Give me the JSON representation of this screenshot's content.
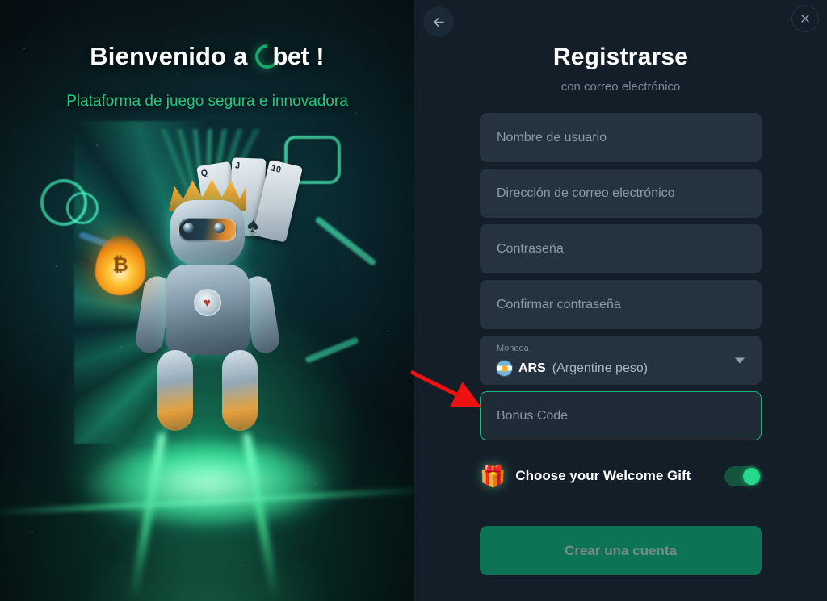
{
  "promo": {
    "title_prefix": "Bienvenido a",
    "logo_text": "bet",
    "title_suffix": "!",
    "subtitle": "Plataforma de juego segura e innovadora",
    "accent_green": "#22c87e",
    "logo_arc_color": "#17a86a",
    "artwork": {
      "description": "robot-king-on-throne",
      "card_labels": [
        "Q",
        "J",
        "10"
      ],
      "card_suit": "♠",
      "coin_symbol": "₿",
      "badge_symbol": "♥"
    }
  },
  "header": {
    "back_icon": "arrow-left-icon",
    "close_icon": "close-icon",
    "title": "Registrarse",
    "subtitle": "con correo electrónico"
  },
  "form": {
    "fields": [
      {
        "name": "username",
        "placeholder": "Nombre de usuario",
        "value": "",
        "focused": false
      },
      {
        "name": "email",
        "placeholder": "Dirección de correo electrónico",
        "value": "",
        "focused": false
      },
      {
        "name": "password",
        "placeholder": "Contraseña",
        "value": "",
        "focused": false
      },
      {
        "name": "confirm-password",
        "placeholder": "Confirmar contraseña",
        "value": "",
        "focused": false
      },
      {
        "name": "bonus-code",
        "placeholder": "Bonus Code",
        "value": "",
        "focused": true
      }
    ],
    "currency": {
      "label": "Moneda",
      "code": "ARS",
      "name": "(Argentine peso)",
      "flag": "argentina-flag-icon",
      "chevron": "chevron-down-icon"
    },
    "gift": {
      "icon": "gift-icon",
      "label": "Choose your Welcome Gift",
      "toggle_on": true,
      "toggle_on_color": "#27d98a",
      "toggle_track_color": "#12543c"
    },
    "submit_label": "Crear una cuenta",
    "submit_color": "#0d7355"
  },
  "annotation": {
    "type": "arrow",
    "color": "#ee1111",
    "points_to": "bonus-code-field"
  },
  "colors": {
    "panel_bg": "#131e28",
    "input_bg": "#253340",
    "focus_border": "#21b77a",
    "placeholder": "#8b9aa8"
  }
}
